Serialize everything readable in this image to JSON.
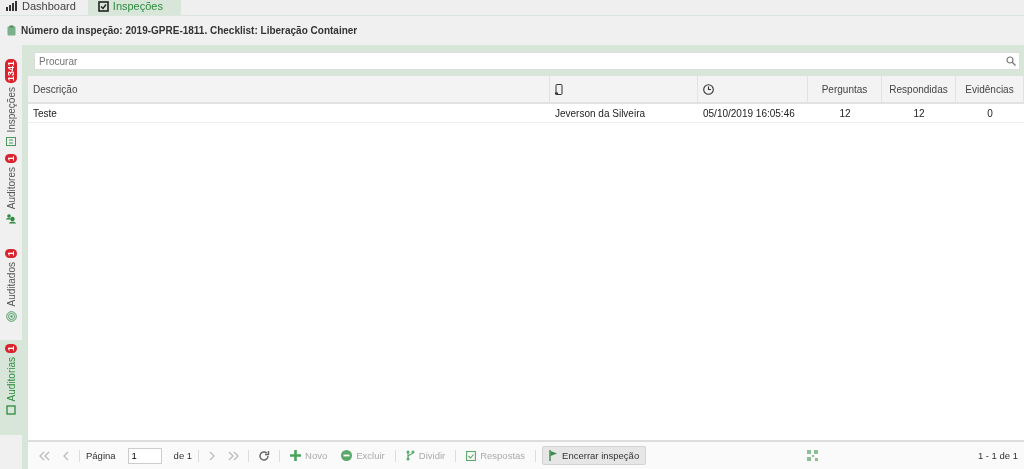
{
  "top_tabs": [
    {
      "label": "Dashboard",
      "kind": "chart",
      "selected": false
    },
    {
      "label": "Inspeções",
      "kind": "check",
      "selected": true
    }
  ],
  "header": {
    "title": "Número da inspeção: 2019-GPRE-1811. Checklist: Liberação Container"
  },
  "side_tabs": [
    {
      "label": "Inspeções",
      "badge": "1341",
      "kind": "list",
      "selected": false
    },
    {
      "label": "Auditores",
      "badge": "1",
      "kind": "people",
      "selected": false
    },
    {
      "label": "Auditados",
      "badge": "1",
      "kind": "target",
      "selected": false
    },
    {
      "label": "Auditorias",
      "badge": "1",
      "kind": "square",
      "selected": true
    }
  ],
  "search": {
    "placeholder": "Procurar"
  },
  "table": {
    "columns": [
      {
        "kind": "text",
        "label": "Descrição"
      },
      {
        "kind": "phone"
      },
      {
        "kind": "clock"
      },
      {
        "kind": "text",
        "label": "Perguntas"
      },
      {
        "kind": "text",
        "label": "Respondidas"
      },
      {
        "kind": "text",
        "label": "Evidências"
      }
    ],
    "rows": [
      {
        "cells": [
          "Teste",
          "Jeverson da Silveira",
          "05/10/2019 16:05:46",
          "12",
          "12",
          "0"
        ],
        "selected": false
      }
    ]
  },
  "pager": {
    "page_label": "Página",
    "page": "1",
    "of_label": "de 1",
    "summary": "1 - 1 de 1"
  },
  "toolbar": [
    {
      "kind": "add",
      "label": "Novo",
      "disabled": true
    },
    {
      "kind": "remove",
      "label": "Excluir",
      "disabled": true
    },
    {
      "kind": "split",
      "label": "Dividir",
      "disabled": true
    },
    {
      "kind": "answers",
      "label": "Respostas",
      "disabled": true
    },
    {
      "kind": "finish",
      "label": "Encerrar inspeção",
      "disabled": false
    }
  ]
}
